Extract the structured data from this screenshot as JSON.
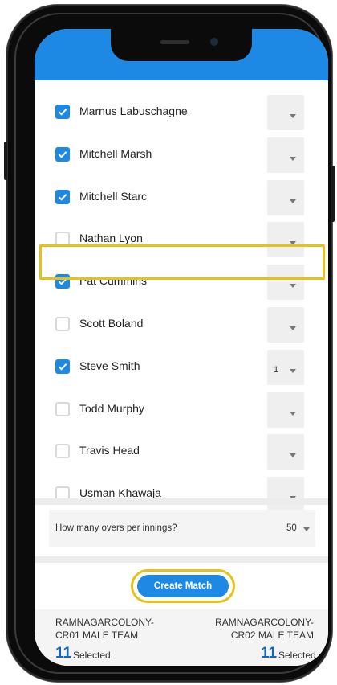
{
  "players": [
    {
      "name": "Marnus Labuschagne",
      "checked": true,
      "order": ""
    },
    {
      "name": "Mitchell Marsh",
      "checked": true,
      "order": ""
    },
    {
      "name": "Mitchell Starc",
      "checked": true,
      "order": ""
    },
    {
      "name": "Nathan Lyon",
      "checked": false,
      "order": ""
    },
    {
      "name": "Pat Cummins",
      "checked": true,
      "order": ""
    },
    {
      "name": "Scott Boland",
      "checked": false,
      "order": ""
    },
    {
      "name": "Steve Smith",
      "checked": true,
      "order": "1"
    },
    {
      "name": "Todd Murphy",
      "checked": false,
      "order": ""
    },
    {
      "name": "Travis Head",
      "checked": false,
      "order": ""
    },
    {
      "name": "Usman Khawaja",
      "checked": false,
      "order": ""
    }
  ],
  "overs": {
    "label": "How many overs per innings?",
    "value": "50"
  },
  "create_button": "Create Match",
  "teams": {
    "left": {
      "line1": "RAMNAGARCOLONY-",
      "line2": "CR01 MALE TEAM",
      "count": "11",
      "selected": "Selected"
    },
    "right": {
      "line1": "RAMNAGARCOLONY-",
      "line2": "CR02 MALE TEAM",
      "count": "11",
      "selected": "Selected"
    }
  },
  "colors": {
    "accent": "#1e88e5",
    "highlight": "#e5c316",
    "count_text": "#1565c0"
  },
  "icons": {
    "checkbox_checked": "check-icon",
    "dropdown": "chevron-down-icon"
  }
}
